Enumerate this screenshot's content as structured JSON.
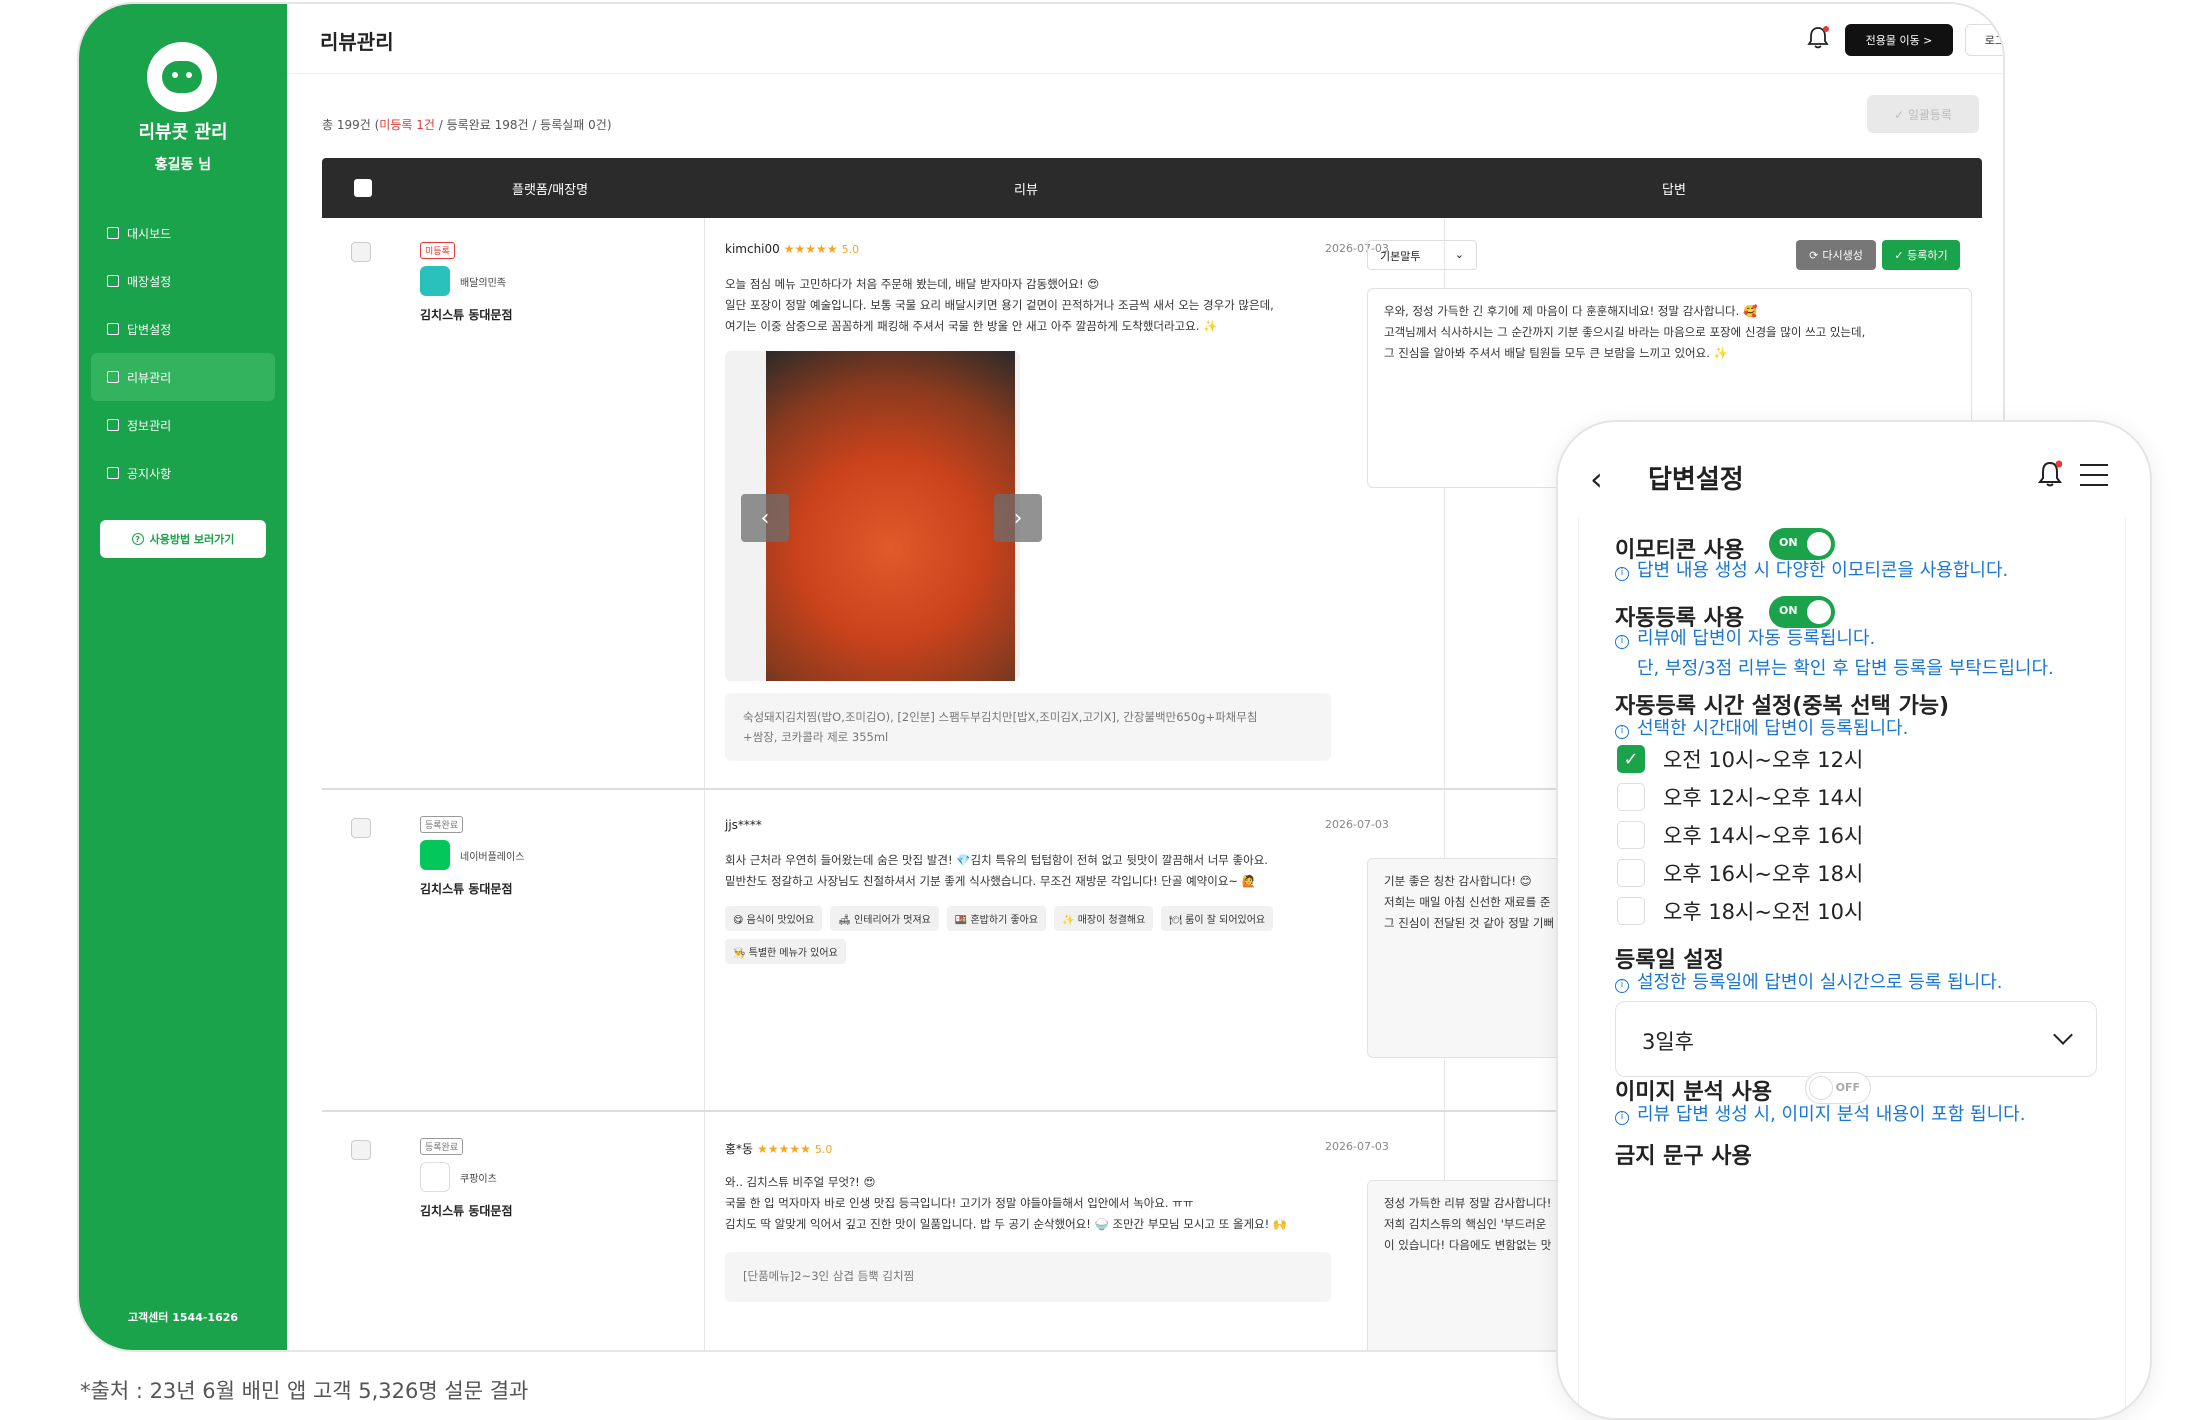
{
  "sidebar": {
    "brand": "리뷰콧 관리",
    "user": "홍길동 님",
    "items": [
      {
        "label": "대시보드"
      },
      {
        "label": "매장설정"
      },
      {
        "label": "답변설정"
      },
      {
        "label": "리뷰관리",
        "active": true
      },
      {
        "label": "정보관리"
      },
      {
        "label": "공지사항"
      }
    ],
    "help_label": "사용방법 보러가기",
    "customer_center": "고객센터 1544-1626"
  },
  "header": {
    "title": "리뷰관리",
    "mall_button": "전용몰 이동 >",
    "logout_button": "로그아웃"
  },
  "summary": {
    "prefix": "총 199건 (",
    "unregistered": "미등록 1건",
    "rest": " / 등록완료 198건 / 등록실패 0건)",
    "bulk_button": "✓ 일괄등록"
  },
  "table": {
    "headers": [
      "플랫폼/매장명",
      "리뷰",
      "답변"
    ],
    "rows": [
      {
        "badge": "미등록",
        "platform": "배달의민족",
        "store": "김치스튜 동대문점",
        "author": "kimchi00",
        "stars": "★★★★★",
        "score": "5.0",
        "date": "2026-07-03",
        "text": "오늘 점심 메뉴 고민하다가 처음 주문해 봤는데, 배달 받자마자 감동했어요! 😍\n일단 포장이 정말 예술입니다. 보통 국물 요리 배달시키면 용기 겉면이 끈적하거나 조금씩 새서 오는 경우가 많은데,\n여기는 이중 삼중으로 꼼꼼하게 패킹해 주셔서 국물 한 방울 안 새고 아주 깔끔하게 도착했더라고요. ✨",
        "menu": "숙성돼지김치찜(밥O,조미김O), [2인분] 스팸두부김치만[밥X,조미김X,고기X], 간장불백만650g+파채무침\n+쌈장, 코카콜라 제로 355ml",
        "tone": "기본말투",
        "regen": "다시생성",
        "register": "✓ 등록하기",
        "reply": "우와, 정성 가득한 긴 후기에 제 마음이 다 훈훈해지네요! 정말 감사합니다. 🥰\n고객님께서 식사하시는 그 순간까지 기분 좋으시길 바라는 마음으로 포장에 신경을 많이 쓰고 있는데,\n그 진심을 알아봐 주셔서 배달 팀원들 모두 큰 보람을 느끼고 있어요. ✨"
      },
      {
        "badge": "등록완료",
        "platform": "네이버플레이스",
        "store": "김치스튜 동대문점",
        "author": "jjs****",
        "date": "2026-07-03",
        "text": "회사 근처라 우연히 들어왔는데 숨은 맛집 발견! 💎김치 특유의 텁텁함이 전혀 없고 뒷맛이 깔끔해서 너무 좋아요.\n밑반찬도 정갈하고 사장님도 친절하셔서 기분 좋게 식사했습니다. 무조건 재방문 각입니다! 단골 예약이요~ 🙋",
        "tags": [
          "😋 음식이 맛있어요",
          "🛋 인테리어가 멋져요",
          "🍱 혼밥하기 좋아요",
          "✨ 매장이 청결해요",
          "🍽 룸이 잘 되어있어요",
          "👨‍🍳 특별한 메뉴가 있어요"
        ],
        "reply": "기분 좋은 칭찬 감사합니다! 😊\n저희는 매일 아침 신선한 재료를 준\n그 진심이 전달된 것 같아 정말 기뻐"
      },
      {
        "badge": "등록완료",
        "platform": "쿠팡이츠",
        "store": "김치스튜 동대문점",
        "author": "홍*동",
        "stars": "★★★★★",
        "score": "5.0",
        "date": "2026-07-03",
        "text": "와.. 김치스튜 비주얼 무엇?! 😍\n국물 한 입 먹자마자 바로 인생 맛집 등극입니다! 고기가 정말 야들야들해서 입안에서 녹아요. ㅠㅠ\n김치도 딱 알맞게 익어서 깊고 진한 맛이 일품입니다. 밥 두 공기 순삭했어요! 🍚 조만간 부모님 모시고 또 올게요! 🙌",
        "menu": "[단품메뉴]2~3인 삼겹 듬뿍 김치찜",
        "reply": "정성 가득한 리뷰 정말 감사합니다!\n저희 김치스튜의 핵심인 '부드러운\n이 있습니다! 다음에도 변함없는 맛"
      }
    ]
  },
  "footnote": "*출처 : 23년 6월 배민 앱 고객 5,326명 설문 결과",
  "mobile": {
    "title": "답변설정",
    "emoticon": {
      "label": "이모티콘 사용",
      "toggle": "ON",
      "info": "답변 내용 생성 시 다양한 이모티콘을 사용합니다."
    },
    "auto_register": {
      "label": "자동등록 사용",
      "toggle": "ON",
      "info1": "리뷰에 답변이 자동 등록됩니다.",
      "info2": "단, 부정/3점 리뷰는 확인 후 답변 등록을 부탁드립니다."
    },
    "schedule": {
      "label": "자동등록 시간 설정(중복 선택 가능)",
      "info": "선택한 시간대에 답변이 등록됩니다.",
      "options": [
        {
          "label": "오전 10시~오후 12시",
          "checked": true
        },
        {
          "label": "오후 12시~오후 14시",
          "checked": false
        },
        {
          "label": "오후 14시~오후 16시",
          "checked": false
        },
        {
          "label": "오후 16시~오후 18시",
          "checked": false
        },
        {
          "label": "오후 18시~오전 10시",
          "checked": false
        }
      ]
    },
    "reg_day": {
      "label": "등록일 설정",
      "info": "설정한 등록일에 답변이 실시간으로 등록 됩니다.",
      "value": "3일후"
    },
    "image_analysis": {
      "label": "이미지 분석 사용",
      "toggle": "OFF",
      "info": "리뷰 답변 생성 시, 이미지 분석 내용이 포함 됩니다."
    },
    "next_label": "금지 문구 사용"
  }
}
